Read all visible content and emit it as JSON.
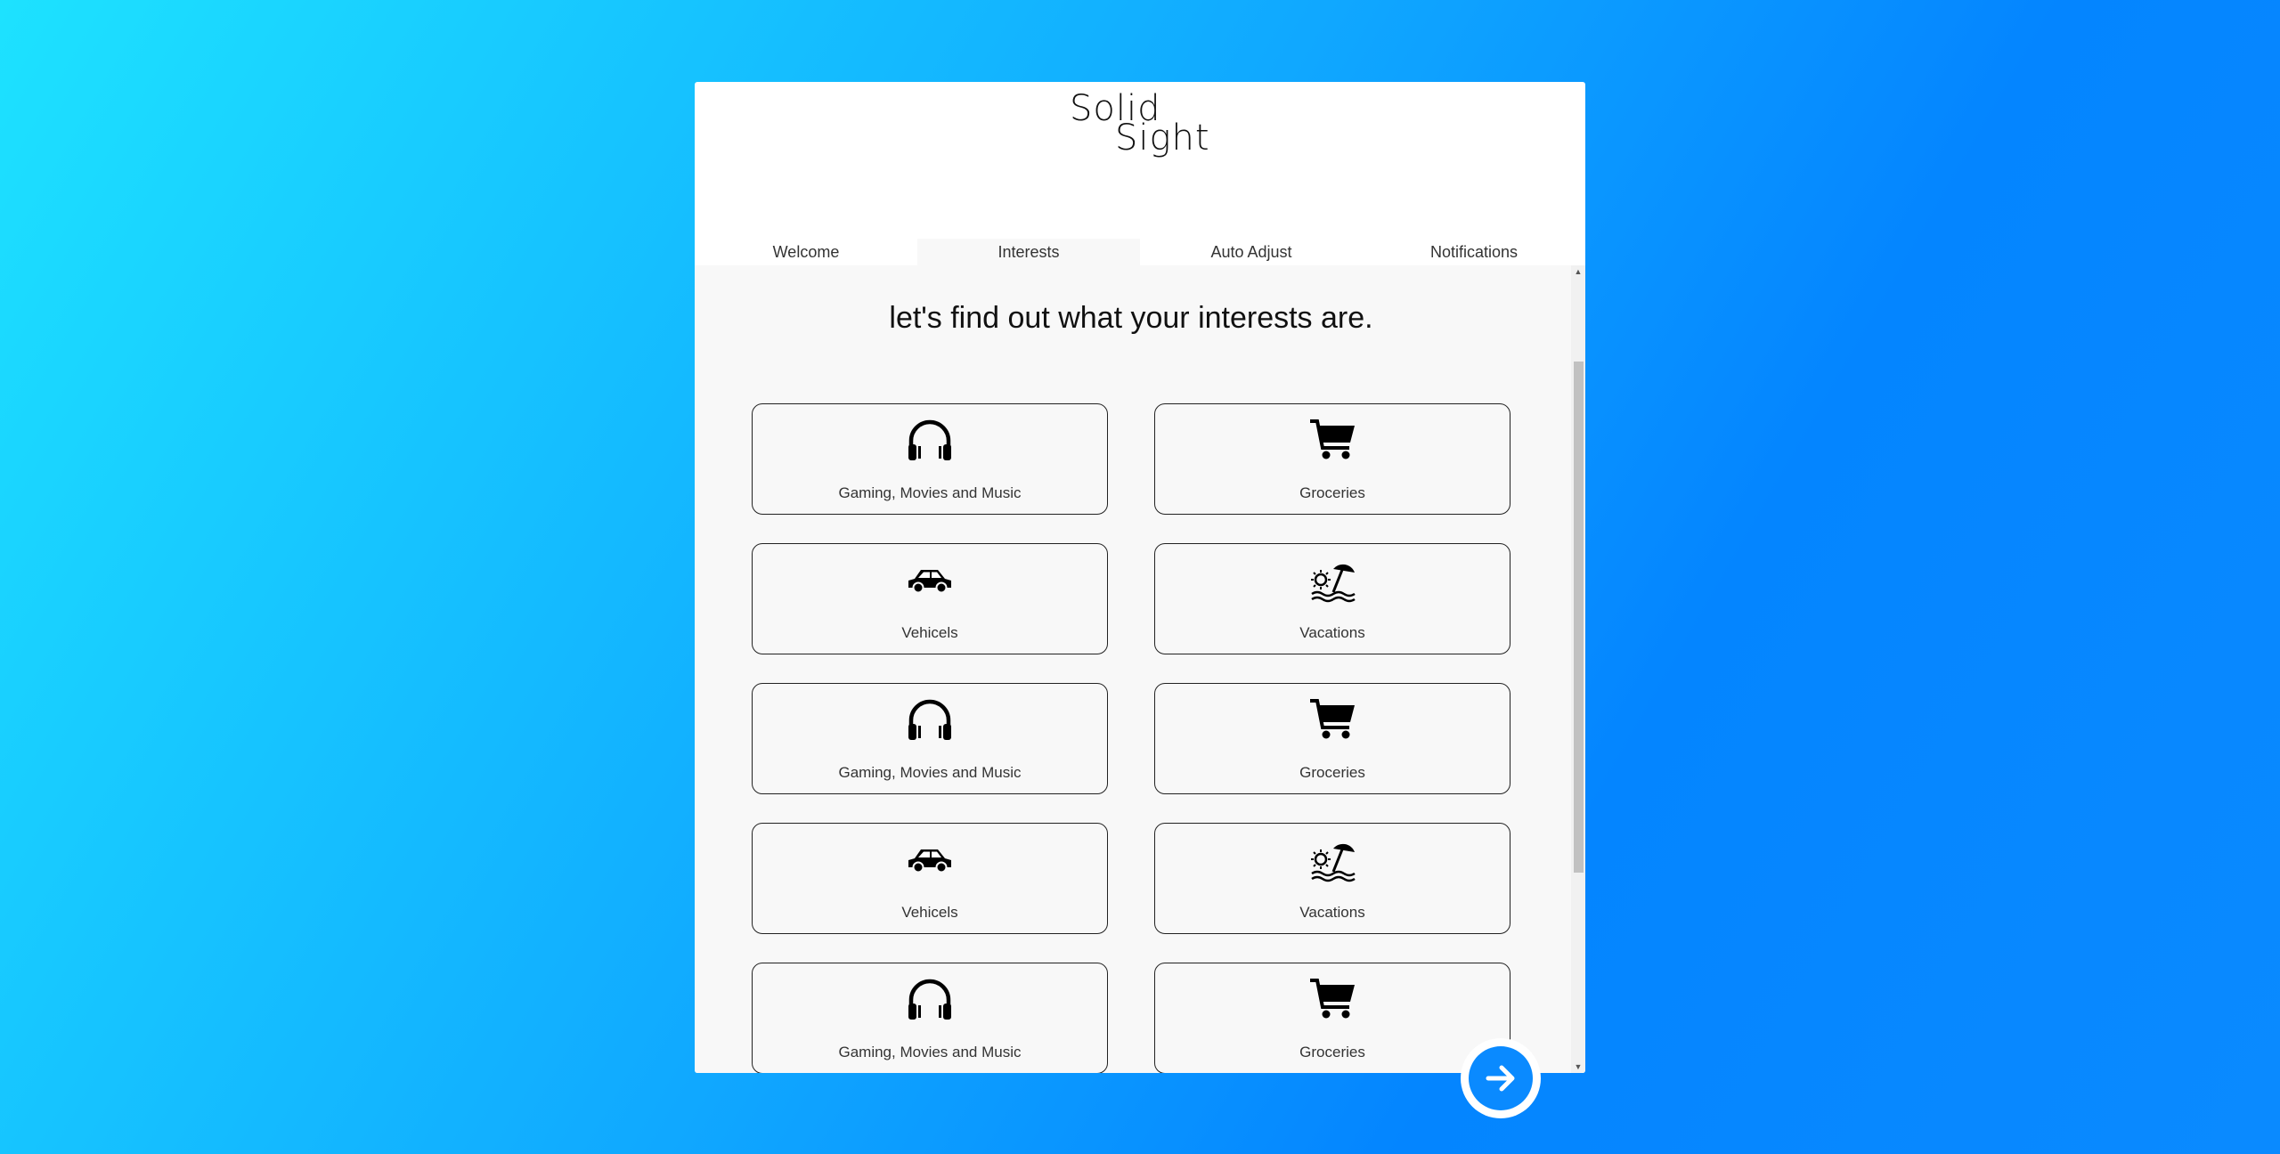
{
  "app": {
    "logo_line1": "Solid",
    "logo_line2": "Sight"
  },
  "tabs": [
    {
      "label": "Welcome",
      "active": false
    },
    {
      "label": "Interests",
      "active": true
    },
    {
      "label": "Auto Adjust",
      "active": false
    },
    {
      "label": "Notifications",
      "active": false
    }
  ],
  "main": {
    "heading": "let's find out what your interests are.",
    "tiles": [
      {
        "label": "Gaming, Movies and Music",
        "icon": "headphones-icon"
      },
      {
        "label": "Groceries",
        "icon": "shopping-cart-icon"
      },
      {
        "label": "Vehicels",
        "icon": "car-icon"
      },
      {
        "label": "Vacations",
        "icon": "beach-umbrella-icon"
      },
      {
        "label": "Gaming, Movies and Music",
        "icon": "headphones-icon"
      },
      {
        "label": "Groceries",
        "icon": "shopping-cart-icon"
      },
      {
        "label": "Vehicels",
        "icon": "car-icon"
      },
      {
        "label": "Vacations",
        "icon": "beach-umbrella-icon"
      },
      {
        "label": "Gaming, Movies and Music",
        "icon": "headphones-icon"
      },
      {
        "label": "Groceries",
        "icon": "shopping-cart-icon"
      }
    ]
  },
  "next_button": {
    "icon": "arrow-right-icon"
  },
  "colors": {
    "accent": "#0a8aff",
    "background_start": "#1de2ff",
    "background_end": "#0485ff"
  }
}
